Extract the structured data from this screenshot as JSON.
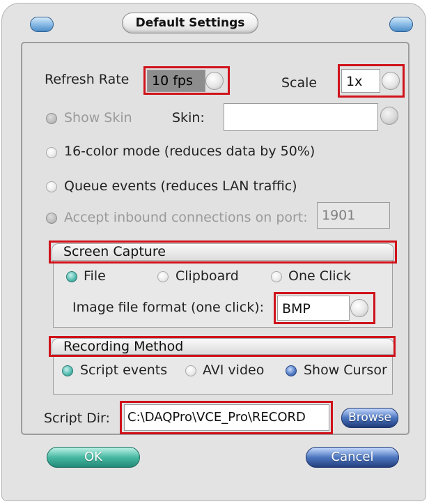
{
  "window": {
    "title": "Default Settings"
  },
  "refresh_rate": {
    "label": "Refresh Rate",
    "value": "10 fps"
  },
  "scale": {
    "label": "Scale",
    "value": "1x"
  },
  "show_skin": {
    "label": "Show Skin",
    "selected": true,
    "disabled": true
  },
  "skin": {
    "label": "Skin:",
    "value": ""
  },
  "options": {
    "color_mode": "16-color mode (reduces data by 50%)",
    "queue_events": "Queue events (reduces LAN traffic)",
    "accept_inbound": "Accept inbound connections on port:",
    "port": "1901"
  },
  "screen_capture": {
    "heading": "Screen Capture",
    "file": "File",
    "clipboard": "Clipboard",
    "one_click": "One Click",
    "selected": "File",
    "format_label": "Image file format (one click):",
    "format_value": "BMP"
  },
  "recording": {
    "heading": "Recording Method",
    "script_events": "Script events",
    "avi_video": "AVI video",
    "show_cursor": "Show Cursor",
    "selected_method": "Script events",
    "show_cursor_checked": true
  },
  "script_dir": {
    "label": "Script Dir:",
    "value": "C:\\DAQPro\\VCE_Pro\\RECORD"
  },
  "buttons": {
    "browse": "Browse",
    "ok": "OK",
    "cancel": "Cancel"
  },
  "colors": {
    "highlight": "#d0121b",
    "ok_accent": "#48b9a3",
    "cancel_accent": "#4d77c0"
  }
}
